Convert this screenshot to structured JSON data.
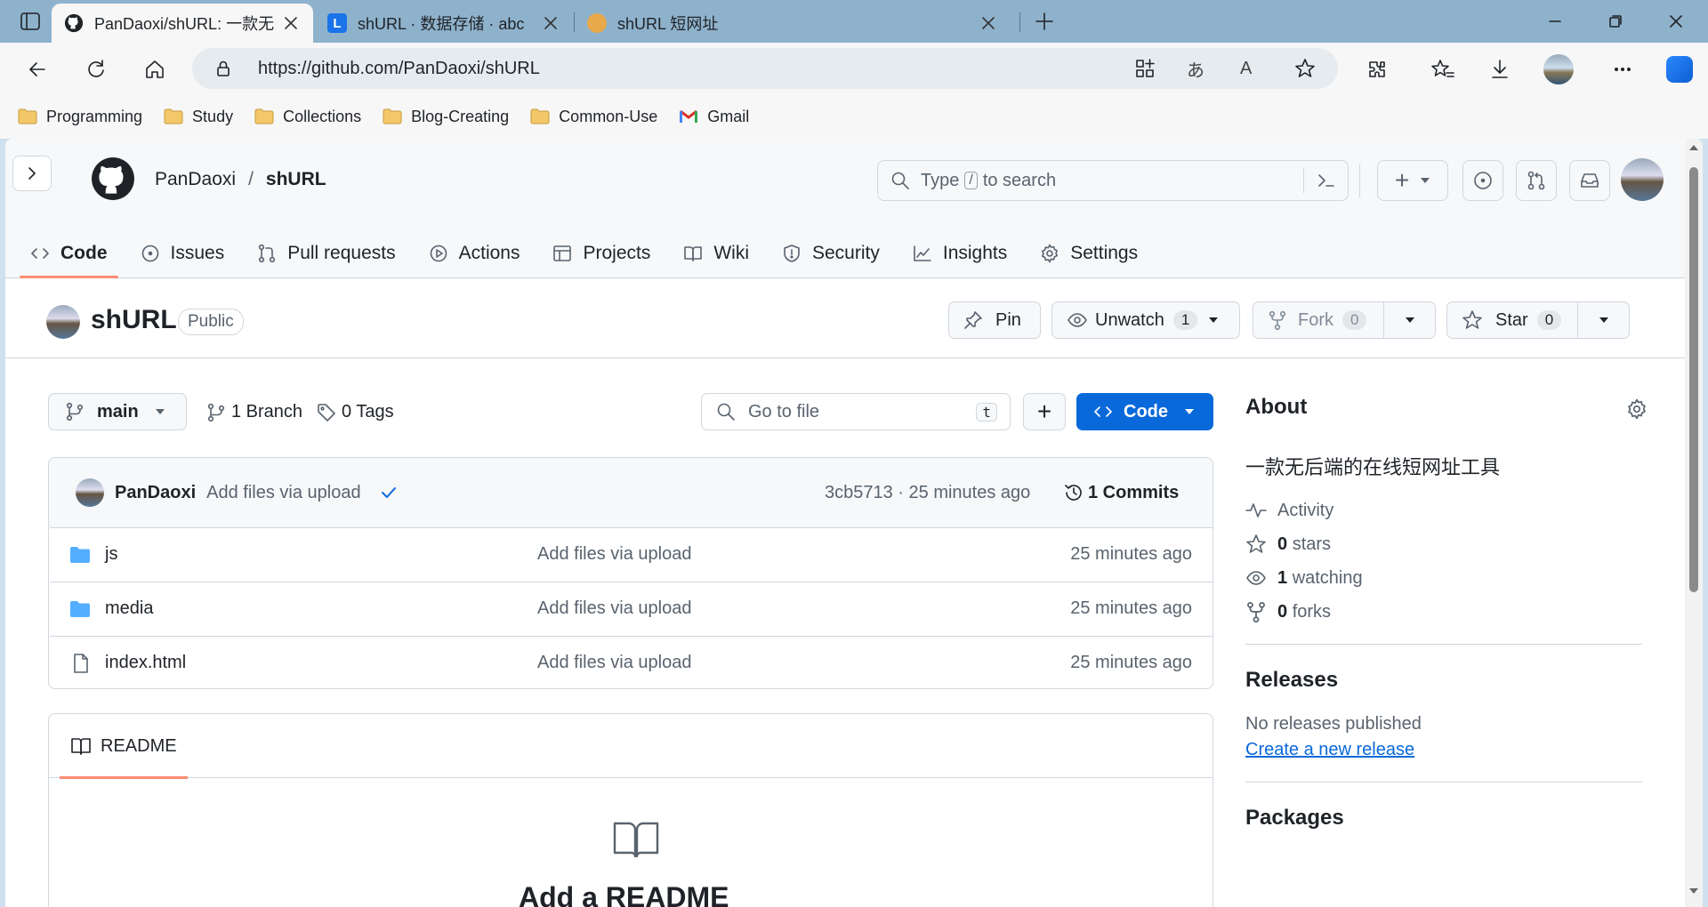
{
  "browser": {
    "tabs": [
      {
        "title": "PanDaoxi/shURL: 一款无后端的在"
      },
      {
        "title": "shURL · 数据存储 · abc"
      },
      {
        "title": "shURL 短网址"
      }
    ],
    "url": "https://github.com/PanDaoxi/shURL",
    "bookmarks": [
      "Programming",
      "Study",
      "Collections",
      "Blog-Creating",
      "Common-Use",
      "Gmail"
    ]
  },
  "header": {
    "owner": "PanDaoxi",
    "separator": "/",
    "repo": "shURL",
    "search_text_before": "Type",
    "search_key": "/",
    "search_text_after": "to search",
    "plus": "+"
  },
  "tabs": [
    "Code",
    "Issues",
    "Pull requests",
    "Actions",
    "Projects",
    "Wiki",
    "Security",
    "Insights",
    "Settings"
  ],
  "repo": {
    "name": "shURL",
    "visibility": "Public",
    "pin": "Pin",
    "unwatch": "Unwatch",
    "watch_count": "1",
    "fork": "Fork",
    "fork_count": "0",
    "star": "Star",
    "star_count": "0"
  },
  "files_bar": {
    "branch": "main",
    "branches": "1 Branch",
    "tags": "0 Tags",
    "goto_placeholder": "Go to file",
    "goto_key": "t",
    "add": "+",
    "code": "Code"
  },
  "commit": {
    "author": "PanDaoxi",
    "message": "Add files via upload",
    "meta": "3cb5713 · 25 minutes ago",
    "commits": "1 Commits"
  },
  "files": [
    {
      "name": "js",
      "type": "folder",
      "message": "Add files via upload",
      "time": "25 minutes ago"
    },
    {
      "name": "media",
      "type": "folder",
      "message": "Add files via upload",
      "time": "25 minutes ago"
    },
    {
      "name": "index.html",
      "type": "file",
      "message": "Add files via upload",
      "time": "25 minutes ago"
    }
  ],
  "readme": {
    "tab": "README",
    "heading": "Add a README"
  },
  "about": {
    "title": "About",
    "description": "一款无后端的在线短网址工具",
    "activity": "Activity",
    "stars": "0",
    "stars_label": "stars",
    "watching": "1",
    "watching_label": "watching",
    "forks": "0",
    "forks_label": "forks"
  },
  "releases": {
    "title": "Releases",
    "none": "No releases published",
    "create": "Create a new release"
  },
  "packages": {
    "title": "Packages"
  },
  "colors": {
    "primary": "#0969da",
    "accent": "#fd8c73",
    "tab_bg": "#8fb2cc"
  }
}
